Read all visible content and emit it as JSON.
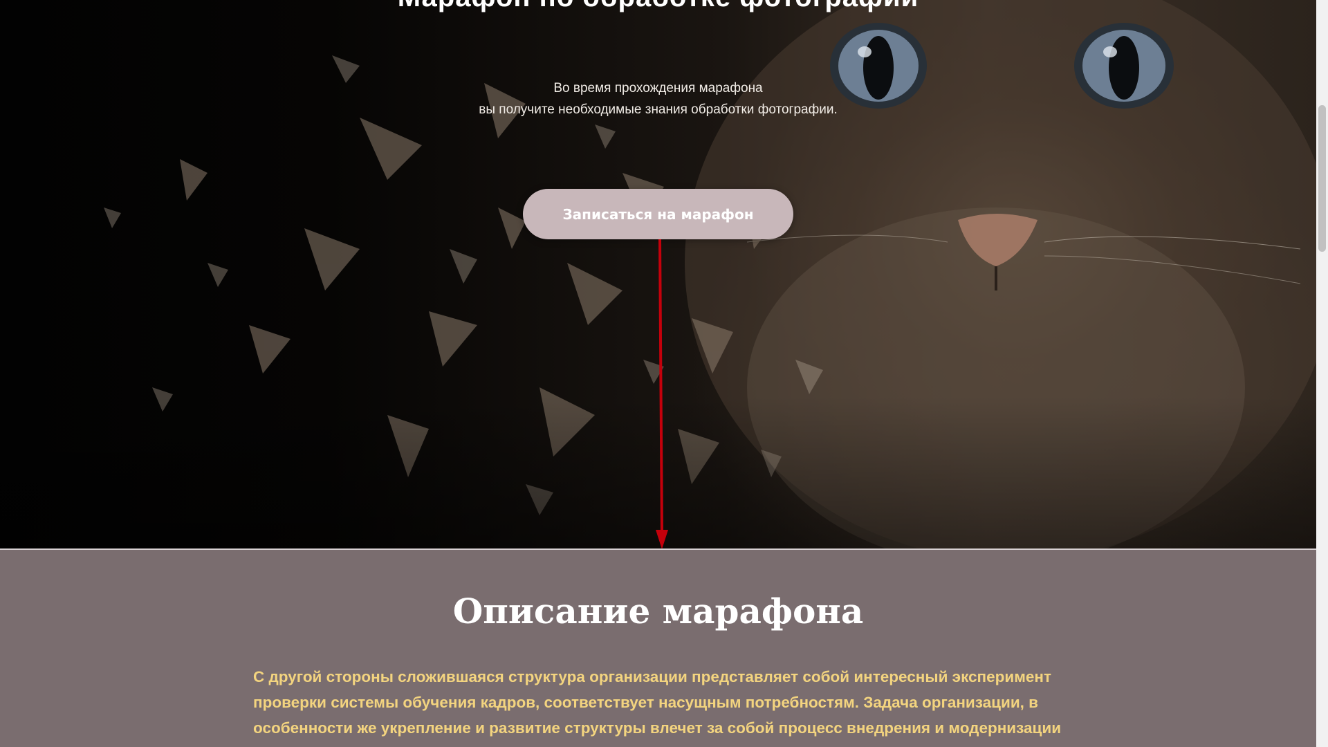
{
  "hero": {
    "title": "Марафон по обработке фотографии",
    "subtitle_line1": "Во время прохождения марафона",
    "subtitle_line2": "вы получите необходимые знания обработки фотографии.",
    "cta_label": "Записаться на марафон"
  },
  "description": {
    "title": "Описание марафона",
    "text": "С другой стороны сложившаяся структура организации представляет собой интересный эксперимент проверки системы обучения кадров, соответствует насущным потребностям. Задача организации, в особенности же укрепление и развитие структуры влечет за собой процесс внедрения и модернизации новых предложений."
  },
  "colors": {
    "cta_background": "#c8b7ba",
    "description_background": "#7a6d6f",
    "description_text": "#f3d47f",
    "arrow": "#c4000b"
  },
  "icons": {
    "arrow": "down-arrow-icon"
  }
}
